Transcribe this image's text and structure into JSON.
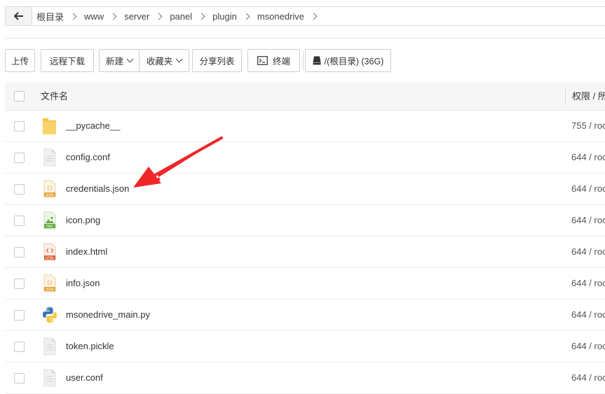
{
  "path": {
    "segments": [
      "根目录",
      "www",
      "server",
      "panel",
      "plugin",
      "msonedrive"
    ]
  },
  "toolbar": {
    "upload": "上传",
    "remote_download": "远程下载",
    "new": "新建",
    "favorites": "收藏夹",
    "share_list": "分享列表",
    "terminal": "终端",
    "disk": "/(根目录) (36G)"
  },
  "table": {
    "col_name": "文件名",
    "col_perm": "权限 / 所",
    "rows": [
      {
        "name": "__pycache__",
        "perm": "755 / roo",
        "icon": "folder-icon"
      },
      {
        "name": "config.conf",
        "perm": "644 / roo",
        "icon": "file-icon"
      },
      {
        "name": "credentials.json",
        "perm": "644 / roo",
        "icon": "json-file-icon"
      },
      {
        "name": "icon.png",
        "perm": "644 / roo",
        "icon": "png-file-icon"
      },
      {
        "name": "index.html",
        "perm": "644 / roo",
        "icon": "html-file-icon"
      },
      {
        "name": "info.json",
        "perm": "644 / roo",
        "icon": "json-file-icon"
      },
      {
        "name": "msonedrive_main.py",
        "perm": "644 / roo",
        "icon": "python-file-icon"
      },
      {
        "name": "token.pickle",
        "perm": "644 / roo",
        "icon": "file-icon"
      },
      {
        "name": "user.conf",
        "perm": "644 / roo",
        "icon": "file-icon"
      }
    ]
  },
  "colors": {
    "annotation_arrow": "#f0262a",
    "folder": "#f5c54a",
    "json_badge": "#e8a33b",
    "html_badge": "#e0623a",
    "png_badge": "#6aad44"
  }
}
